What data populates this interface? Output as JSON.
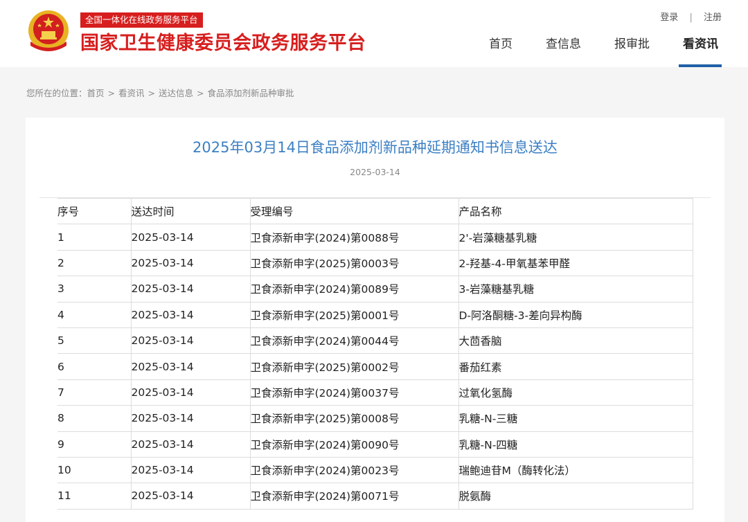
{
  "header": {
    "slogan": "全国一体化在线政务服务平台",
    "site_title": "国家卫生健康委员会政务服务平台",
    "login": "登录",
    "divider": "|",
    "register": "注册",
    "brand_color": "#d71e1e"
  },
  "nav": {
    "items": [
      {
        "label": "首页",
        "active": false
      },
      {
        "label": "查信息",
        "active": false
      },
      {
        "label": "报审批",
        "active": false
      },
      {
        "label": "看资讯",
        "active": true
      }
    ],
    "accent_color": "#1f5fa8"
  },
  "breadcrumb": {
    "prefix": "您所在的位置：",
    "items": [
      "首页",
      "看资讯",
      "送达信息",
      "食品添加剂新品种审批"
    ],
    "separator": ">"
  },
  "article": {
    "title": "2025年03月14日食品添加剂新品种延期通知书信息送达",
    "date": "2025-03-14",
    "title_color": "#3b7fc4"
  },
  "table": {
    "headers": [
      "序号",
      "送达时间",
      "受理编号",
      "产品名称"
    ],
    "rows": [
      [
        "1",
        "2025-03-14",
        "卫食添新申字(2024)第0088号",
        "2'-岩藻糖基乳糖"
      ],
      [
        "2",
        "2025-03-14",
        "卫食添新申字(2025)第0003号",
        "2-羟基-4-甲氧基苯甲醛"
      ],
      [
        "3",
        "2025-03-14",
        "卫食添新申字(2024)第0089号",
        "3-岩藻糖基乳糖"
      ],
      [
        "4",
        "2025-03-14",
        "卫食添新申字(2025)第0001号",
        "D-阿洛酮糖-3-差向异构酶"
      ],
      [
        "5",
        "2025-03-14",
        "卫食添新申字(2024)第0044号",
        "大茴香脑"
      ],
      [
        "6",
        "2025-03-14",
        "卫食添新申字(2025)第0002号",
        "番茄红素"
      ],
      [
        "7",
        "2025-03-14",
        "卫食添新申字(2024)第0037号",
        "过氧化氢酶"
      ],
      [
        "8",
        "2025-03-14",
        "卫食添新申字(2025)第0008号",
        "乳糖-N-三糖"
      ],
      [
        "9",
        "2025-03-14",
        "卫食添新申字(2024)第0090号",
        "乳糖-N-四糖"
      ],
      [
        "10",
        "2025-03-14",
        "卫食添新申字(2024)第0023号",
        "瑞鲍迪苷M（酶转化法）"
      ],
      [
        "11",
        "2025-03-14",
        "卫食添新申字(2024)第0071号",
        "脱氨酶"
      ]
    ]
  }
}
